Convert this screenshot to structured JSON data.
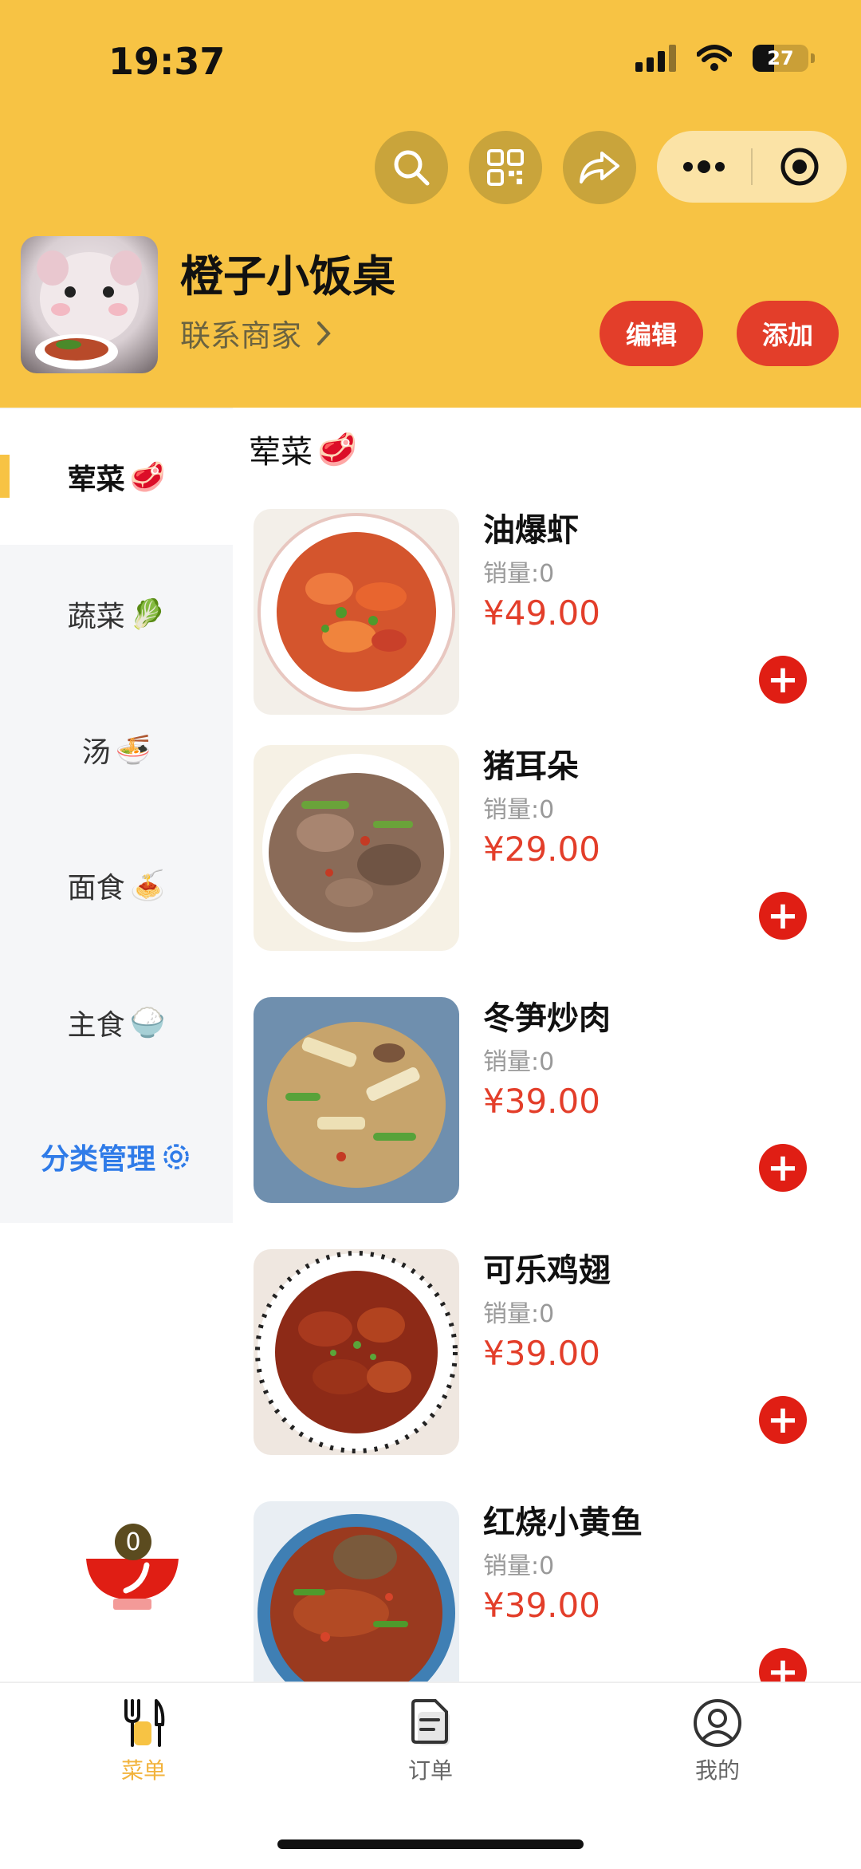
{
  "status_bar": {
    "time": "19:37",
    "battery": "27"
  },
  "toolbar": {
    "search_icon": "search-icon",
    "qr_icon": "qrcode-icon",
    "share_icon": "share-icon",
    "more_icon": "more-icon",
    "close_icon": "record-icon"
  },
  "shop": {
    "name": "橙子小饭桌",
    "contact_label": "联系商家",
    "edit_label": "编辑",
    "add_label": "添加"
  },
  "categories": [
    {
      "label": "荤菜",
      "emoji": "🥩"
    },
    {
      "label": "蔬菜",
      "emoji": "🥬"
    },
    {
      "label": "汤",
      "emoji": "🍜"
    },
    {
      "label": "面食",
      "emoji": "🍝"
    },
    {
      "label": "主食",
      "emoji": "🍚"
    }
  ],
  "category_manage": {
    "label": "分类管理"
  },
  "section": {
    "title": "荤菜",
    "emoji": "🥩"
  },
  "dishes": [
    {
      "name": "油爆虾",
      "sold": "销量:0",
      "price": "¥49.00"
    },
    {
      "name": "猪耳朵",
      "sold": "销量:0",
      "price": "¥29.00"
    },
    {
      "name": "冬笋炒肉",
      "sold": "销量:0",
      "price": "¥39.00"
    },
    {
      "name": "可乐鸡翅",
      "sold": "销量:0",
      "price": "¥39.00"
    },
    {
      "name": "红烧小黄鱼",
      "sold": "销量:0",
      "price": "¥39.00"
    }
  ],
  "cart": {
    "count": "0"
  },
  "tabs": [
    {
      "label": "菜单"
    },
    {
      "label": "订单"
    },
    {
      "label": "我的"
    }
  ],
  "colors": {
    "brand_yellow": "#F7C344",
    "accent_red": "#E33E2A",
    "link_blue": "#2F7BE8"
  }
}
